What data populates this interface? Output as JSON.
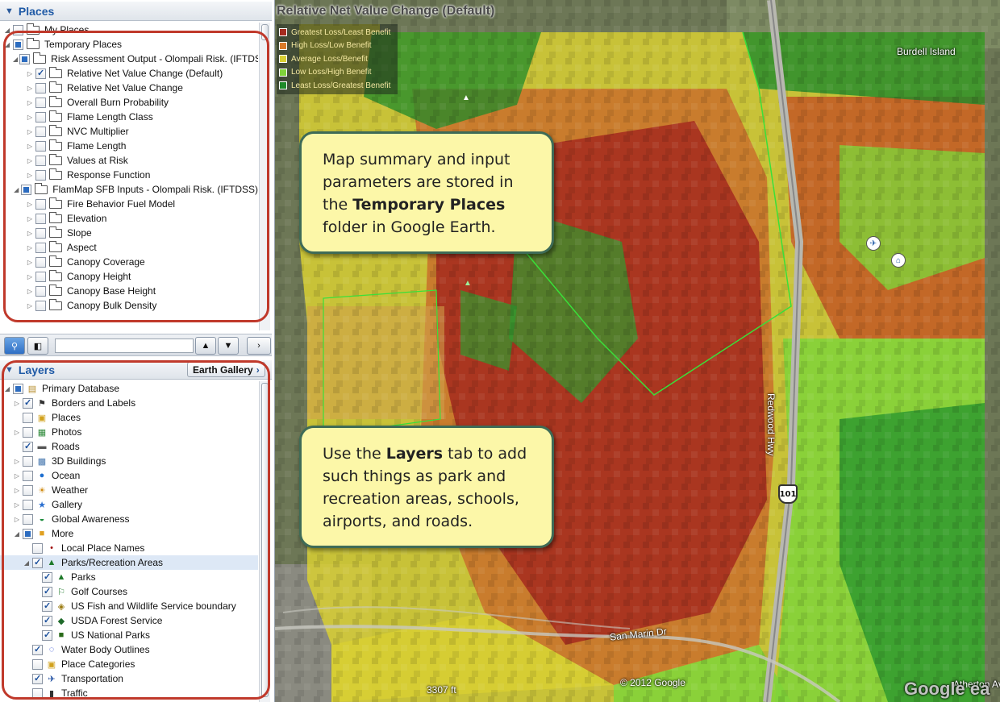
{
  "places": {
    "header": "Places",
    "items": [
      {
        "label": "My Places",
        "level": 0
      },
      {
        "label": "Temporary Places",
        "level": 0
      },
      {
        "label": "Risk Assessment Output - Olompali Risk. (IFTDSS)",
        "level": 1
      },
      {
        "label": "Relative Net Value Change (Default)",
        "level": 2,
        "checked": true
      },
      {
        "label": "Relative Net Value Change",
        "level": 2
      },
      {
        "label": "Overall Burn Probability",
        "level": 2
      },
      {
        "label": "Flame Length Class",
        "level": 2
      },
      {
        "label": "NVC Multiplier",
        "level": 2
      },
      {
        "label": "Flame Length",
        "level": 2
      },
      {
        "label": "Values at Risk",
        "level": 2
      },
      {
        "label": "Response Function",
        "level": 2
      },
      {
        "label": "FlamMap SFB Inputs - Olompali Risk. (IFTDSS)",
        "level": 1
      },
      {
        "label": "Fire Behavior Fuel Model",
        "level": 2
      },
      {
        "label": "Elevation",
        "level": 2
      },
      {
        "label": "Slope",
        "level": 2
      },
      {
        "label": "Aspect",
        "level": 2
      },
      {
        "label": "Canopy Coverage",
        "level": 2
      },
      {
        "label": "Canopy Height",
        "level": 2
      },
      {
        "label": "Canopy Base Height",
        "level": 2
      },
      {
        "label": "Canopy Bulk Density",
        "level": 2
      }
    ]
  },
  "search": {
    "placeholder": ""
  },
  "layers": {
    "header": "Layers",
    "gallery_button": "Earth Gallery",
    "items": [
      {
        "label": "Primary Database",
        "level": 0,
        "icon": "database-icon"
      },
      {
        "label": "Borders and Labels",
        "level": 1,
        "icon": "flag-icon",
        "checked": true
      },
      {
        "label": "Places",
        "level": 1,
        "icon": "places-icon"
      },
      {
        "label": "Photos",
        "level": 1,
        "icon": "photo-icon"
      },
      {
        "label": "Roads",
        "level": 1,
        "icon": "road-icon",
        "checked": true
      },
      {
        "label": "3D Buildings",
        "level": 1,
        "icon": "building-icon"
      },
      {
        "label": "Ocean",
        "level": 1,
        "icon": "ocean-icon"
      },
      {
        "label": "Weather",
        "level": 1,
        "icon": "sun-icon"
      },
      {
        "label": "Gallery",
        "level": 1,
        "icon": "star-icon"
      },
      {
        "label": "Global Awareness",
        "level": 1,
        "icon": "globe-icon"
      },
      {
        "label": "More",
        "level": 1,
        "icon": "more-icon"
      },
      {
        "label": "Local Place Names",
        "level": 2,
        "icon": "dot-icon"
      },
      {
        "label": "Parks/Recreation Areas",
        "level": 2,
        "icon": "tree-icon",
        "checked": true
      },
      {
        "label": "Parks",
        "level": 3,
        "icon": "tree-icon",
        "checked": true
      },
      {
        "label": "Golf Courses",
        "level": 3,
        "icon": "golf-icon",
        "checked": true
      },
      {
        "label": "US Fish and Wildlife Service boundary",
        "level": 3,
        "icon": "fws-icon",
        "checked": true
      },
      {
        "label": "USDA Forest Service",
        "level": 3,
        "icon": "usda-icon",
        "checked": true
      },
      {
        "label": "US National Parks",
        "level": 3,
        "icon": "nps-icon",
        "checked": true
      },
      {
        "label": "Water Body Outlines",
        "level": 2,
        "icon": "water-icon",
        "checked": true
      },
      {
        "label": "Place Categories",
        "level": 2,
        "icon": "places-icon"
      },
      {
        "label": "Transportation",
        "level": 2,
        "icon": "plane-icon",
        "checked": true
      },
      {
        "label": "Traffic",
        "level": 2,
        "icon": "traffic-icon"
      }
    ]
  },
  "map": {
    "title": "Relative Net Value Change (Default)",
    "legend": [
      {
        "label": "Greatest Loss/Least Benefit",
        "color": "#a52a1e"
      },
      {
        "label": "High Loss/Low Benefit",
        "color": "#d97a2a"
      },
      {
        "label": "Average Loss/Benefit",
        "color": "#d8cf33"
      },
      {
        "label": "Low Loss/High Benefit",
        "color": "#7fd33a"
      },
      {
        "label": "Least Loss/Greatest Benefit",
        "color": "#1f8a2a"
      }
    ],
    "callout_places": {
      "pre": "Map summary and input parameters are stored in the ",
      "bold": "Temporary Places",
      "post": " folder in Google Earth."
    },
    "callout_layers": {
      "pre": "Use the ",
      "bold": "Layers",
      "post": " tab to add such things as park and recreation areas, schools, airports, and roads."
    },
    "labels": {
      "burdell": "Burdell Island",
      "redwood": "Redwood Hwy",
      "hwy": "101",
      "sanmarin": "San Marin Dr",
      "atherton": "Atherton Ave",
      "scale": "3307 ft",
      "copyright": "© 2012 Google",
      "google": "Google ea"
    }
  }
}
